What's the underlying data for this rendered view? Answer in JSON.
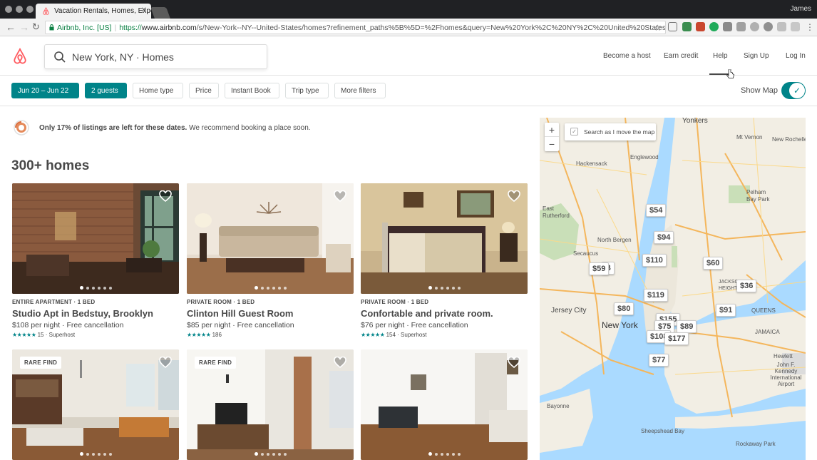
{
  "browser": {
    "tab_title": "Vacation Rentals, Homes, Expe",
    "user": "James",
    "secure_label": "Airbnb, Inc. [US]",
    "url_protocol": "https://",
    "url_host": "www.airbnb.com",
    "url_rest": "/s/New-York--NY--United-States/homes?refinement_paths%5B%5D=%2Fhomes&query=New%20York%2C%20NY%2C%20United%20States&ch..."
  },
  "header": {
    "search_value": "New York, NY · Homes",
    "nav": [
      "Become a host",
      "Earn credit",
      "Help",
      "Sign Up",
      "Log In"
    ],
    "brand_color": "#FF5A5F"
  },
  "filters": {
    "dates": "Jun 20 – Jun 22",
    "guests": "2 guests",
    "home_type": "Home type",
    "price": "Price",
    "instant_book": "Instant Book",
    "trip_type": "Trip type",
    "more": "More filters",
    "show_map": "Show Map",
    "show_map_on": true,
    "accent": "#008489"
  },
  "notice": {
    "bold": "Only 17% of listings are left for these dates.",
    "rest": "We recommend booking a place soon."
  },
  "results_title": "300+ homes",
  "listings": [
    {
      "kind": "ENTIRE APARTMENT · 1 BED",
      "name": "Studio Apt in Bedstuy, Brooklyn",
      "price": "$108",
      "price_rest": " per night · Free cancellation",
      "stars": "★★★★★",
      "reviews": "15 · Superhost"
    },
    {
      "kind": "PRIVATE ROOM · 1 BED",
      "name": "Clinton Hill Guest Room",
      "price": "$85",
      "price_rest": " per night · Free cancellation",
      "stars": "★★★★★",
      "reviews": "186"
    },
    {
      "kind": "PRIVATE ROOM · 1 BED",
      "name": "Confortable and private room.",
      "price": "$76",
      "price_rest": " per night · Free cancellation",
      "stars": "★★★★★",
      "reviews": "154 · Superhost"
    },
    {
      "badge": "RARE FIND"
    },
    {
      "badge": "RARE FIND"
    },
    {
      "badge": ""
    }
  ],
  "map": {
    "search_as_move": "Search as I move the map",
    "zoom_in": "+",
    "zoom_out": "−",
    "pins": [
      "$54",
      "$94",
      "$110",
      "$59",
      "$60",
      "$36",
      "$119",
      "$80",
      "$91",
      "$155",
      "$75",
      "$89",
      "$108",
      "$177",
      "$77",
      "B"
    ],
    "labels": [
      "Yonkers",
      "Mt Vernon",
      "New Rochelle",
      "Englewood",
      "Hackensack",
      "Pelham Bay Park",
      "East Rutherford",
      "North Bergen",
      "Secaucus",
      "Jersey City",
      "New York",
      "QUEENS",
      "JACKSON HEIGHTS",
      "JAMAICA",
      "John F. Kennedy International Airport",
      "Hewlett",
      "Sheepshead Bay",
      "Rockaway Park",
      "Bayonne"
    ]
  }
}
